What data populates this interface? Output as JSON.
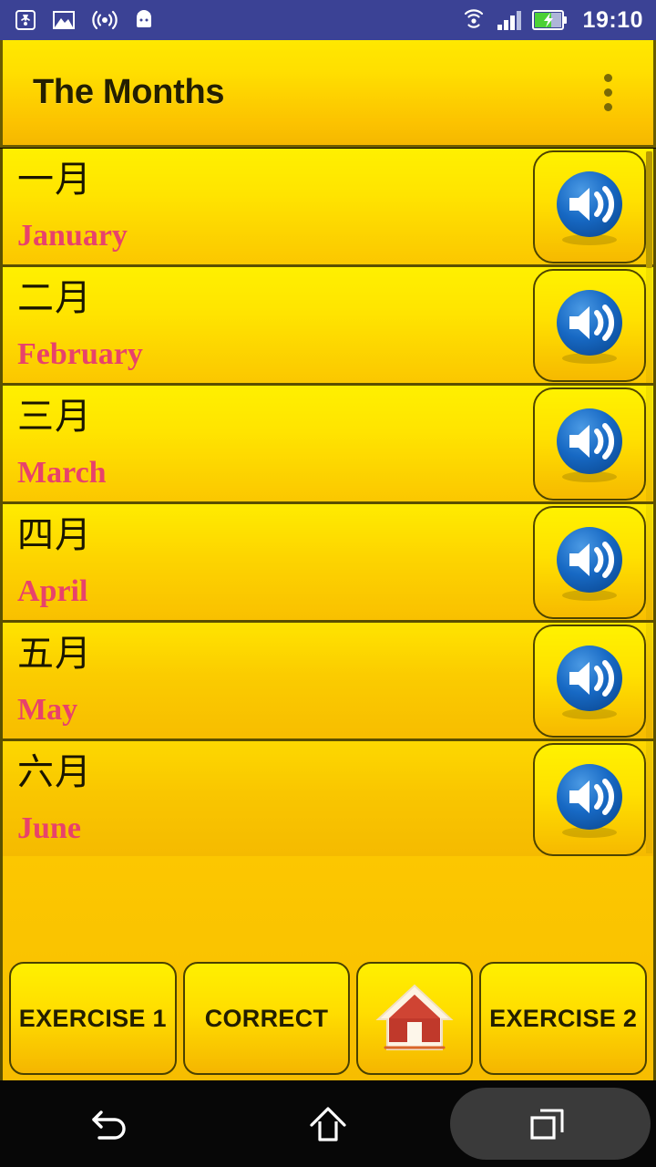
{
  "status_bar": {
    "icons_left": [
      "cast-icon",
      "photo-icon",
      "broadcast-icon",
      "android-head-icon"
    ],
    "icons_right": [
      "wifi-icon",
      "cellular-signal-icon",
      "battery-charging-icon"
    ],
    "time": "19:10",
    "background_color": "#3b4295",
    "text_color": "#ffffff"
  },
  "app_bar": {
    "title": "The Months",
    "overflow_menu_icon": "more-vertical-icon",
    "background_gradient_top": "#ffe800",
    "background_gradient_bottom": "#f5b800",
    "title_color": "#241f00"
  },
  "list": {
    "speaker_icon": "speaker-volume-icon",
    "accent_english_color": "#e8426b",
    "chinese_color": "#1a1500",
    "rows": [
      {
        "chinese": "一月",
        "english": "January"
      },
      {
        "chinese": "二月",
        "english": "February"
      },
      {
        "chinese": "三月",
        "english": "March"
      },
      {
        "chinese": "四月",
        "english": "April"
      },
      {
        "chinese": "五月",
        "english": "May"
      },
      {
        "chinese": "六月",
        "english": "June"
      }
    ]
  },
  "footer": {
    "buttons": [
      {
        "label": "EXERCISE 1",
        "name": "exercise-1-button"
      },
      {
        "label": "CORRECT",
        "name": "correct-button"
      },
      {
        "label": "",
        "name": "home-button",
        "icon": "house-icon"
      },
      {
        "label": "EXERCISE 2",
        "name": "exercise-2-button"
      }
    ]
  },
  "nav_bar": {
    "items": [
      {
        "name": "back-nav-button",
        "icon": "back-arrow-icon"
      },
      {
        "name": "home-nav-button",
        "icon": "home-outline-icon"
      },
      {
        "name": "recents-nav-button",
        "icon": "recents-squares-icon",
        "highlighted": true
      }
    ],
    "background_color": "#070707"
  }
}
